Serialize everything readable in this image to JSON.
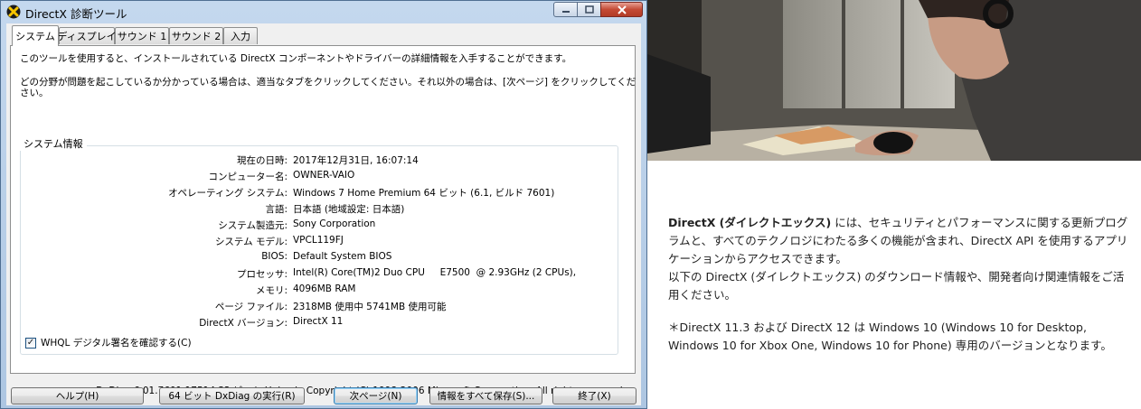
{
  "window": {
    "title": "DirectX 診断ツール",
    "controls": {
      "minimize": "─",
      "maximize": "□",
      "close": "✕"
    }
  },
  "tabs": [
    {
      "label": "システム",
      "active": true
    },
    {
      "label": "ディスプレイ",
      "active": false
    },
    {
      "label": "サウンド 1",
      "active": false
    },
    {
      "label": "サウンド 2",
      "active": false
    },
    {
      "label": "入力",
      "active": false
    }
  ],
  "intro": {
    "line1": "このツールを使用すると、インストールされている DirectX コンポーネントやドライバーの詳細情報を入手することができます。",
    "line2": "どの分野が問題を起こしているか分かっている場合は、適当なタブをクリックしてください。それ以外の場合は、[次ページ] をクリックしてくだ",
    "line3": "さい。"
  },
  "system_info": {
    "heading": "システム情報",
    "rows": [
      {
        "label": "現在の日時:",
        "value": "2017年12月31日, 16:07:14"
      },
      {
        "label": "コンピューター名:",
        "value": "OWNER-VAIO"
      },
      {
        "label": "オペレーティング システム:",
        "value": "Windows 7 Home Premium 64 ビット (6.1, ビルド 7601)"
      },
      {
        "label": "言語:",
        "value": "日本語 (地域設定: 日本語)"
      },
      {
        "label": "システム製造元:",
        "value": "Sony Corporation"
      },
      {
        "label": "システム モデル:",
        "value": "VPCL119FJ"
      },
      {
        "label": "BIOS:",
        "value": "Default System BIOS"
      },
      {
        "label": "プロセッサ:",
        "value": "Intel(R) Core(TM)2 Duo CPU     E7500  @ 2.93GHz (2 CPUs),"
      },
      {
        "label": "メモリ:",
        "value": "4096MB RAM"
      },
      {
        "label": "ページ ファイル:",
        "value": "2318MB 使用中 5741MB 使用可能"
      },
      {
        "label": "DirectX バージョン:",
        "value": "DirectX 11"
      }
    ]
  },
  "whql": {
    "label": "WHQL デジタル署名を確認する(C)",
    "checked": true,
    "check_glyph": "✓"
  },
  "footer": {
    "version": "DxDiag 6.01.7601.17514 32 ビット Unicode  Copyright (C) 1998-2006 Microsoft Corporation.  All rights reserved."
  },
  "buttons": {
    "help": "ヘルプ(H)",
    "run64": "64 ビット DxDiag の実行(R)",
    "next": "次ページ(N)",
    "save_all": "情報をすべて保存(S)...",
    "exit": "終了(X)"
  },
  "article": {
    "p1_bold": "DirectX (ダイレクトエックス)",
    "p1_rest": " には、セキュリティとパフォーマンスに関する更新プログラムと、すべてのテクノロジにわたる多くの機能が含まれ、DirectX API を使用するアプリケーションからアクセスできます。",
    "p2": "以下の DirectX (ダイレクトエックス) のダウンロード情報や、開発者向け関連情報をご活用ください。",
    "p3": "＊DirectX 11.3 および DirectX 12 は Windows 10 (Windows 10 for Desktop, Windows 10 for Xbox One, Windows 10 for Phone) 専用のバージョンとなります。"
  },
  "colors": {
    "titlebar": "#c4d8ee",
    "close_button": "#c44a35",
    "panel_background": "#ffffff",
    "dialog_background": "#f0f0f0"
  }
}
